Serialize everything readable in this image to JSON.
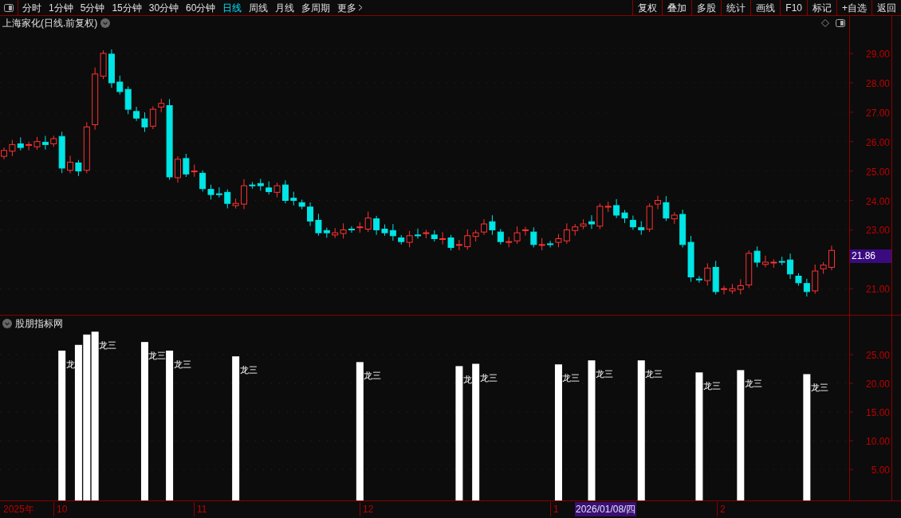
{
  "toolbar": {
    "periods": [
      {
        "label": "分时",
        "selected": false
      },
      {
        "label": "1分钟",
        "selected": false
      },
      {
        "label": "5分钟",
        "selected": false
      },
      {
        "label": "15分钟",
        "selected": false
      },
      {
        "label": "30分钟",
        "selected": false
      },
      {
        "label": "60分钟",
        "selected": false
      },
      {
        "label": "日线",
        "selected": true
      },
      {
        "label": "周线",
        "selected": false
      },
      {
        "label": "月线",
        "selected": false
      },
      {
        "label": "多周期",
        "selected": false
      }
    ],
    "more": "更多",
    "actions": [
      "复权",
      "叠加",
      "多股",
      "统计",
      "画线",
      "F10",
      "标记",
      "+自选",
      "返回"
    ]
  },
  "price_panel": {
    "title": "上海家化(日线.前复权)",
    "price_axis": [
      "29.00",
      "28.00",
      "27.00",
      "26.00",
      "25.00",
      "24.00",
      "23.00",
      "21.00"
    ],
    "last_price": "21.86"
  },
  "indicator_panel": {
    "title": "股朋指标网",
    "value_axis": [
      "25.00",
      "20.00",
      "15.00",
      "10.00",
      "5.00"
    ],
    "signal_labels": [
      "龙",
      "龙三",
      "龙三",
      "龙三",
      "龙三",
      "龙三",
      "龙",
      "龙三",
      "龙三",
      "龙三",
      "龙三",
      "龙三",
      "龙三",
      "龙三"
    ]
  },
  "date_axis": {
    "year": "2025年",
    "months": [
      "10",
      "11",
      "12",
      "1",
      "2"
    ],
    "cursor_date": "2026/01/08/四"
  }
}
